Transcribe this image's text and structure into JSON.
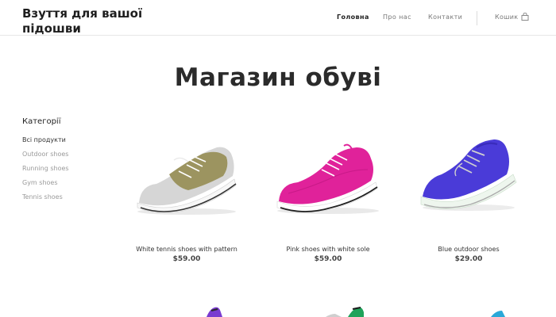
{
  "header": {
    "logo": "Взуття для вашої підошви",
    "nav": [
      {
        "label": "Головна"
      },
      {
        "label": "Про нас"
      },
      {
        "label": "Контакти"
      }
    ],
    "cart_label": "Кошик"
  },
  "main": {
    "title": "Магазин обуві"
  },
  "sidebar": {
    "heading": "Категорії",
    "items": [
      {
        "label": "Всі продукти"
      },
      {
        "label": "Outdoor shoes"
      },
      {
        "label": "Running shoes"
      },
      {
        "label": "Gym shoes"
      },
      {
        "label": "Tennis shoes"
      }
    ]
  },
  "products": [
    {
      "name": "White tennis shoes with pattern",
      "price": "$59.00",
      "color": "#9c9460"
    },
    {
      "name": "Pink shoes with white sole",
      "price": "$59.00",
      "color": "#e0229a"
    },
    {
      "name": "Blue outdoor shoes",
      "price": "$29.00",
      "color": "#4a3bd8"
    }
  ]
}
